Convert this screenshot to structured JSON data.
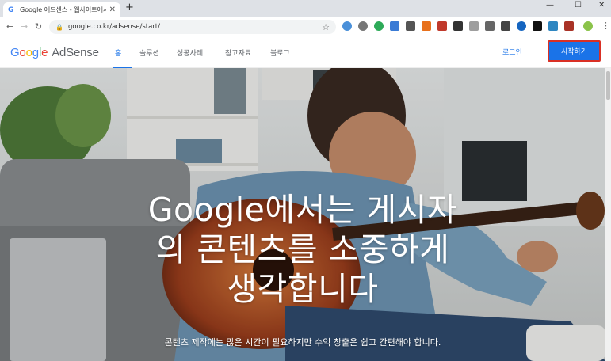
{
  "browser": {
    "tab_title": "Google 애드센스 - 웹사이트에서",
    "tab_favicon": "G",
    "close_glyph": "✕",
    "newtab_glyph": "+",
    "url": "google.co.kr/adsense/start/",
    "window_controls": [
      "—",
      "☐",
      "✕"
    ]
  },
  "site": {
    "logo_letters": [
      "G",
      "o",
      "o",
      "g",
      "l",
      "e"
    ],
    "logo_product": "AdSense",
    "nav": [
      "홈",
      "솔루션",
      "성공사례",
      "참고자료",
      "블로그"
    ],
    "login_label": "로그인",
    "start_label": "시작하기",
    "accent_color": "#1a73e8"
  },
  "hero": {
    "headline_lines": [
      "Google에서는 게시자",
      "의 콘텐츠를 소중하게",
      "생각합니다"
    ],
    "subtitle": "콘텐츠 제작에는 많은 시간이 필요하지만 수익 창출은 쉽고 간편해야 합니다."
  }
}
